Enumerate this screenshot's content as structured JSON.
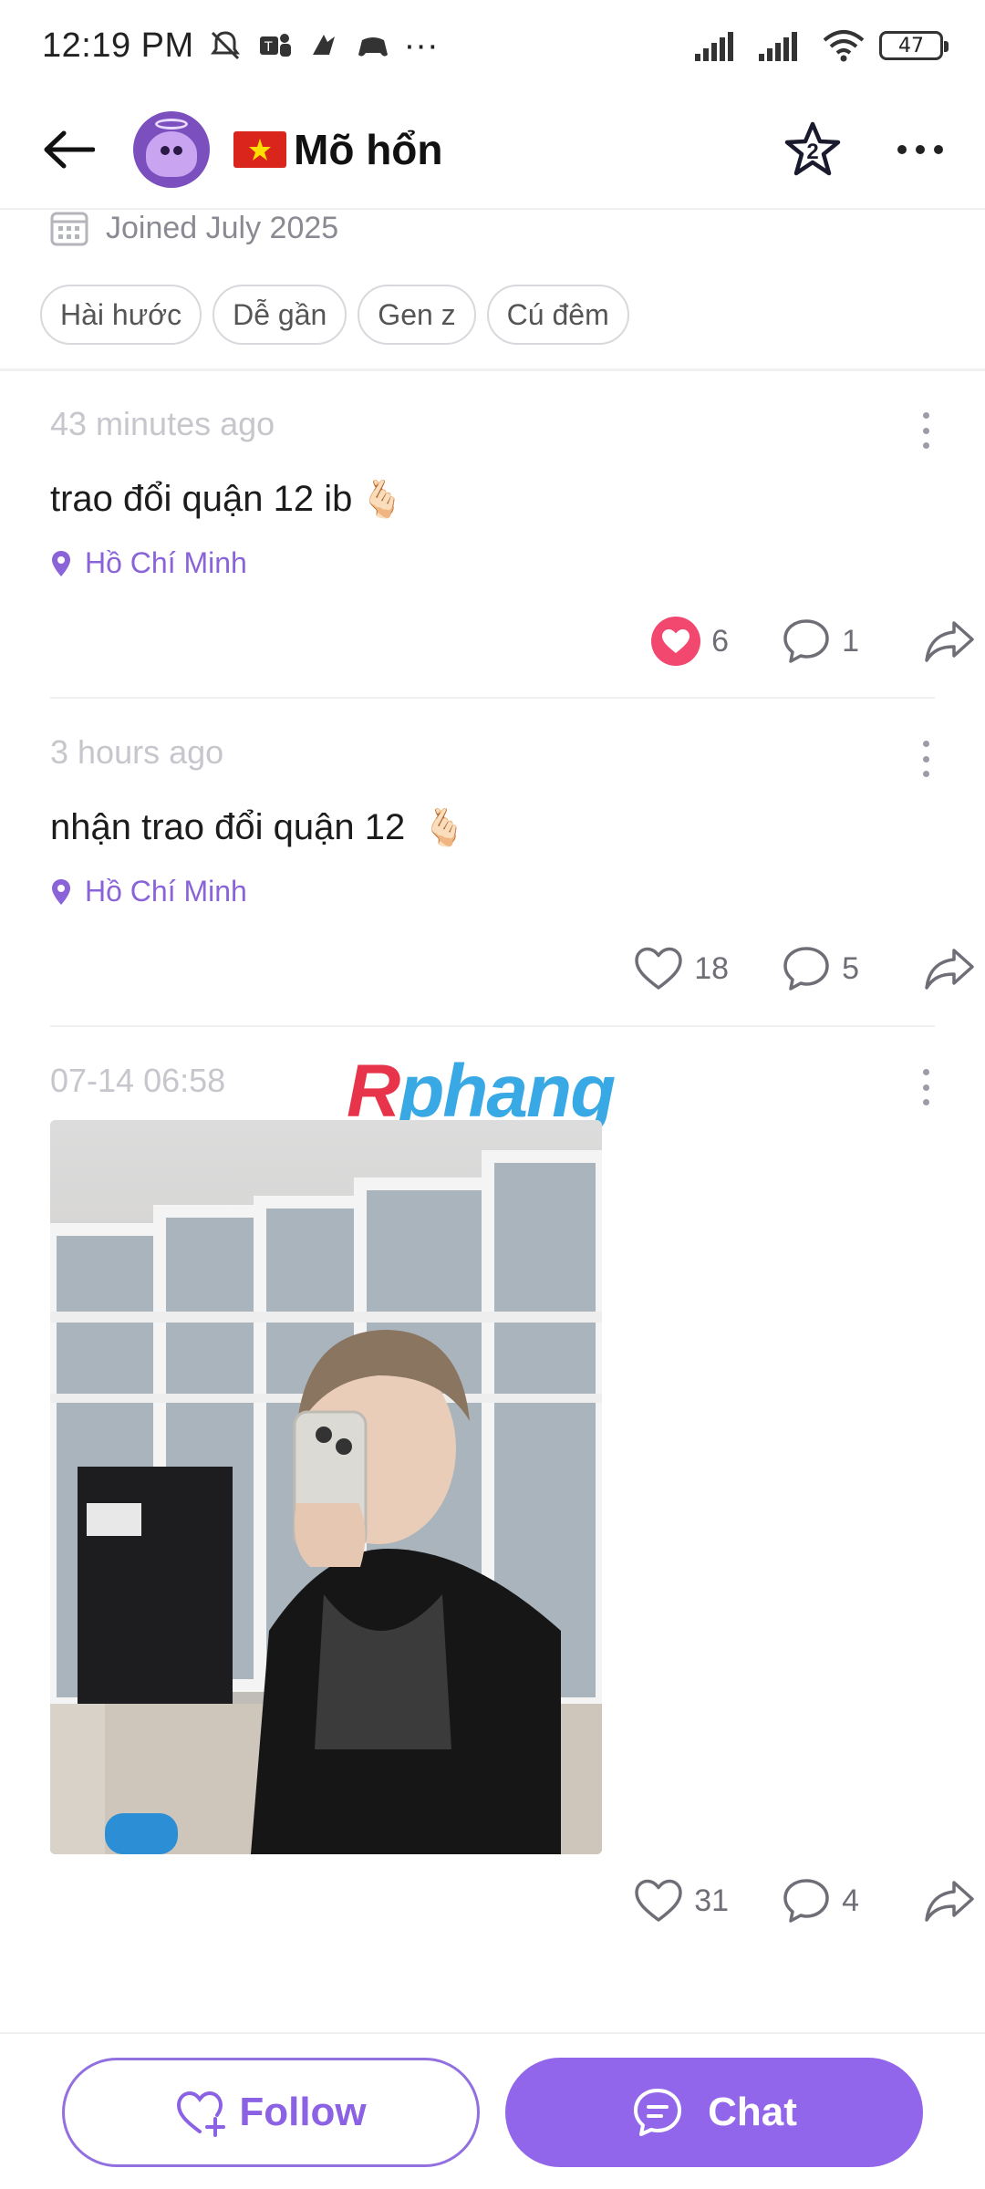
{
  "status_bar": {
    "time": "12:19 PM",
    "more": "···",
    "battery": "47"
  },
  "header": {
    "profile_name": "Mõ hổn",
    "star_badge_count": "2"
  },
  "profile": {
    "joined": "Joined July 2025",
    "tags": [
      "Hài hước",
      "Dễ gần",
      "Gen z",
      "Cú đêm"
    ]
  },
  "posts": [
    {
      "time": "43 minutes ago",
      "text": "trao đổi quận 12 ib",
      "emoji": "🫰🏻",
      "location": "Hồ Chí Minh",
      "likes": "6",
      "liked": true,
      "comments": "1"
    },
    {
      "time": "3 hours ago",
      "text": "nhận trao đổi quận 12",
      "emoji": "🫰🏻",
      "location": "Hồ Chí Minh",
      "likes": "18",
      "liked": false,
      "comments": "5"
    },
    {
      "time": "07-14 06:58",
      "likes": "31",
      "liked": false,
      "comments": "4"
    }
  ],
  "watermark": {
    "first": "R",
    "rest": "phang"
  },
  "bottom": {
    "follow_label": "Follow",
    "chat_label": "Chat"
  },
  "colors": {
    "accent": "#9266ea",
    "like": "#f2486f",
    "location": "#8a63d8"
  }
}
